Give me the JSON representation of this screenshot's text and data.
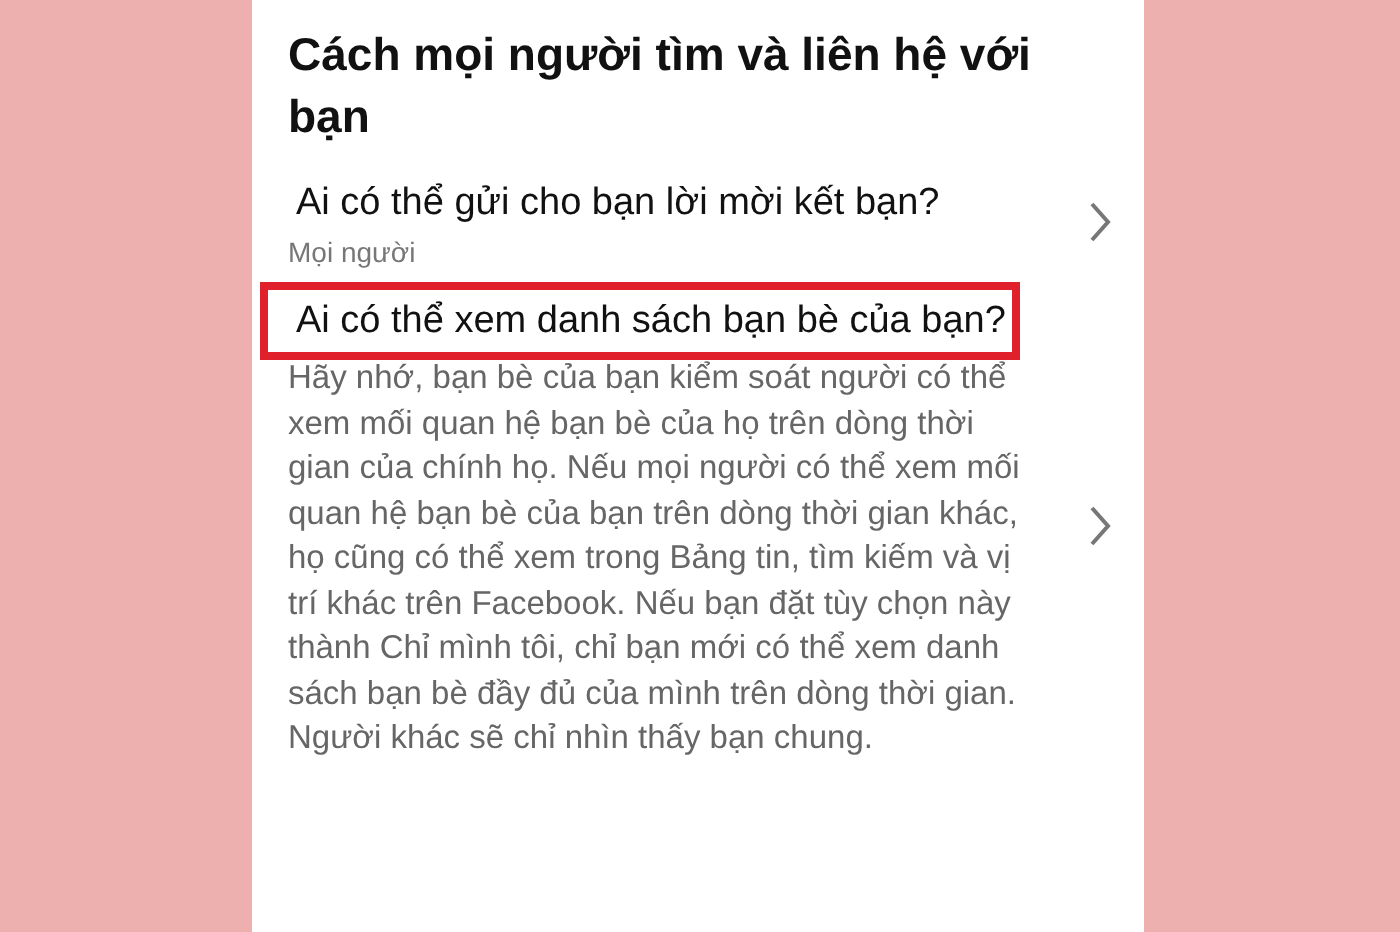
{
  "section": {
    "title": "Cách mọi người tìm và liên hệ với bạn"
  },
  "items": [
    {
      "title": "Ai có thể gửi cho bạn lời mời kết bạn?",
      "value": "Mọi người",
      "highlighted": false
    },
    {
      "title": "Ai có thể xem danh sách bạn bè của bạn?",
      "description": "Hãy nhớ, bạn bè của bạn kiểm soát người có thể xem mối quan hệ bạn bè của họ trên dòng thời gian của chính họ. Nếu mọi người có thể xem mối quan hệ bạn bè của bạn trên dòng thời gian khác, họ cũng có thể xem trong Bảng tin, tìm kiếm và vị trí khác trên Facebook. Nếu bạn đặt tùy chọn này thành Chỉ mình tôi, chỉ bạn mới có thể xem danh sách bạn bè đầy đủ của mình trên dòng thời gian. Người khác sẽ chỉ nhìn thấy bạn chung.",
      "highlighted": true
    }
  ]
}
